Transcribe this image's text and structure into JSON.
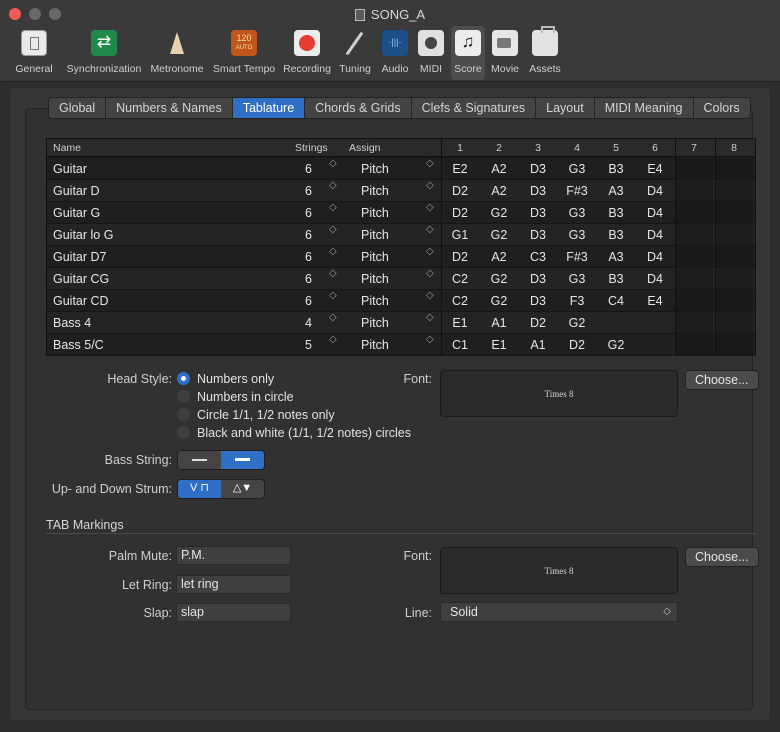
{
  "window": {
    "title": "SONG_A"
  },
  "toolbar": {
    "items": [
      {
        "label": "General",
        "icon": "general-icon"
      },
      {
        "label": "Synchronization",
        "icon": "sync-icon"
      },
      {
        "label": "Metronome",
        "icon": "metronome-icon"
      },
      {
        "label": "Smart Tempo",
        "icon": "smart-tempo-icon",
        "badge_top": "120",
        "badge_bottom": "AUTO"
      },
      {
        "label": "Recording",
        "icon": "record-icon"
      },
      {
        "label": "Tuning",
        "icon": "tuning-fork-icon"
      },
      {
        "label": "Audio",
        "icon": "audio-icon"
      },
      {
        "label": "MIDI",
        "icon": "midi-icon"
      },
      {
        "label": "Score",
        "icon": "score-icon",
        "active": true
      },
      {
        "label": "Movie",
        "icon": "movie-icon"
      },
      {
        "label": "Assets",
        "icon": "assets-icon"
      }
    ]
  },
  "tabs": [
    "Global",
    "Numbers & Names",
    "Tablature",
    "Chords & Grids",
    "Clefs & Signatures",
    "Layout",
    "MIDI Meaning",
    "Colors"
  ],
  "active_tab": "Tablature",
  "table": {
    "headers": {
      "name": "Name",
      "strings": "Strings",
      "assign": "Assign",
      "cols": [
        "1",
        "2",
        "3",
        "4",
        "5",
        "6",
        "7",
        "8"
      ]
    },
    "rows": [
      {
        "name": "Guitar",
        "strings": "6",
        "assign": "Pitch",
        "notes": [
          "E2",
          "A2",
          "D3",
          "G3",
          "B3",
          "E4",
          "",
          ""
        ]
      },
      {
        "name": "Guitar D",
        "strings": "6",
        "assign": "Pitch",
        "notes": [
          "D2",
          "A2",
          "D3",
          "F#3",
          "A3",
          "D4",
          "",
          ""
        ]
      },
      {
        "name": "Guitar G",
        "strings": "6",
        "assign": "Pitch",
        "notes": [
          "D2",
          "G2",
          "D3",
          "G3",
          "B3",
          "D4",
          "",
          ""
        ]
      },
      {
        "name": "Guitar lo G",
        "strings": "6",
        "assign": "Pitch",
        "notes": [
          "G1",
          "G2",
          "D3",
          "G3",
          "B3",
          "D4",
          "",
          ""
        ]
      },
      {
        "name": "Guitar D7",
        "strings": "6",
        "assign": "Pitch",
        "notes": [
          "D2",
          "A2",
          "C3",
          "F#3",
          "A3",
          "D4",
          "",
          ""
        ]
      },
      {
        "name": "Guitar CG",
        "strings": "6",
        "assign": "Pitch",
        "notes": [
          "C2",
          "G2",
          "D3",
          "G3",
          "B3",
          "D4",
          "",
          ""
        ]
      },
      {
        "name": "Guitar CD",
        "strings": "6",
        "assign": "Pitch",
        "notes": [
          "C2",
          "G2",
          "D3",
          "F3",
          "C4",
          "E4",
          "",
          ""
        ]
      },
      {
        "name": "Bass 4",
        "strings": "4",
        "assign": "Pitch",
        "notes": [
          "E1",
          "A1",
          "D2",
          "G2",
          "",
          "",
          "",
          ""
        ]
      },
      {
        "name": "Bass 5/C",
        "strings": "5",
        "assign": "Pitch",
        "notes": [
          "C1",
          "E1",
          "A1",
          "D2",
          "G2",
          "",
          "",
          ""
        ]
      }
    ]
  },
  "head_style": {
    "label": "Head Style:",
    "options": [
      "Numbers only",
      "Numbers in circle",
      "Circle 1/1, 1/2 notes only",
      "Black and white (1/1, 1/2 notes) circles"
    ],
    "selected": 0
  },
  "font1": {
    "label": "Font:",
    "preview": "Times 8",
    "button": "Choose..."
  },
  "bass_string": {
    "label": "Bass String:",
    "selected": 1
  },
  "strum": {
    "label": "Up- and Down Strum:",
    "opt1": "V ⊓",
    "opt2": "△▼",
    "selected": 0
  },
  "tab_markings": {
    "title": "TAB Markings",
    "palm_mute_label": "Palm Mute:",
    "palm_mute_value": "P.M.",
    "let_ring_label": "Let Ring:",
    "let_ring_value": "let ring",
    "slap_label": "Slap:",
    "slap_value": "slap",
    "font_label": "Font:",
    "font_preview": "Times 8",
    "font_button": "Choose...",
    "line_label": "Line:",
    "line_value": "Solid"
  },
  "colors": {
    "accent": "#2f6fc6",
    "close": "#f25b58"
  }
}
